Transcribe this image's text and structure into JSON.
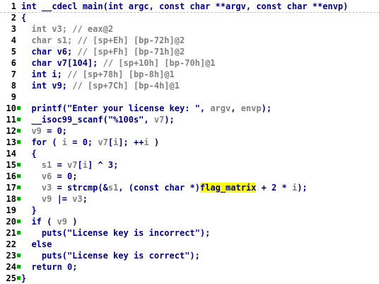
{
  "editor": {
    "colors": {
      "keyword": "#000080",
      "variable": "#000080",
      "comment": "#808080",
      "string": "#008000",
      "number": "#008000",
      "highlight": "#ffff00",
      "breakpoint_dot": "#00a000"
    },
    "lines": [
      {
        "num": "1",
        "dot": false,
        "tokens": [
          {
            "t": "int __cdecl main(int argc, const char **argv, const char **envp)",
            "c": "t-black"
          }
        ]
      },
      {
        "num": "2",
        "dot": false,
        "tokens": [
          {
            "t": "{",
            "c": "t-black"
          }
        ]
      },
      {
        "num": "3",
        "dot": false,
        "tokens": [
          {
            "t": "  int v3; ",
            "c": "t-dim"
          },
          {
            "t": "// eax@2",
            "c": "t-cmt"
          }
        ]
      },
      {
        "num": "4",
        "dot": false,
        "tokens": [
          {
            "t": "  char s1; ",
            "c": "t-dim"
          },
          {
            "t": "// [sp+Eh] [bp-72h]@2",
            "c": "t-cmt"
          }
        ]
      },
      {
        "num": "5",
        "dot": false,
        "tokens": [
          {
            "t": "  char v6; ",
            "c": "t-black"
          },
          {
            "t": "// [sp+Fh] [bp-71h]@2",
            "c": "t-cmt"
          }
        ]
      },
      {
        "num": "6",
        "dot": false,
        "tokens": [
          {
            "t": "  char v7[104]; ",
            "c": "t-black"
          },
          {
            "t": "// [sp+10h] [bp-70h]@1",
            "c": "t-cmt"
          }
        ]
      },
      {
        "num": "7",
        "dot": false,
        "tokens": [
          {
            "t": "  int i; ",
            "c": "t-black"
          },
          {
            "t": "// [sp+78h] [bp-8h]@1",
            "c": "t-cmt"
          }
        ]
      },
      {
        "num": "8",
        "dot": false,
        "tokens": [
          {
            "t": "  int v9; ",
            "c": "t-black"
          },
          {
            "t": "// [sp+7Ch] [bp-4h]@1",
            "c": "t-cmt"
          }
        ]
      },
      {
        "num": "9",
        "dot": false,
        "tokens": [
          {
            "t": "",
            "c": "t-black"
          }
        ]
      },
      {
        "num": "10",
        "dot": true,
        "tokens": [
          {
            "t": "  printf(",
            "c": "t-black"
          },
          {
            "t": "\"Enter your license key: \"",
            "c": "t-black"
          },
          {
            "t": ", ",
            "c": "t-black"
          },
          {
            "t": "argv",
            "c": "t-dim"
          },
          {
            "t": ", ",
            "c": "t-black"
          },
          {
            "t": "envp",
            "c": "t-dim"
          },
          {
            "t": ");",
            "c": "t-black"
          }
        ]
      },
      {
        "num": "11",
        "dot": true,
        "tokens": [
          {
            "t": "  __isoc99_scanf(",
            "c": "t-black"
          },
          {
            "t": "\"%100s\"",
            "c": "t-black"
          },
          {
            "t": ", ",
            "c": "t-black"
          },
          {
            "t": "v7",
            "c": "t-dim"
          },
          {
            "t": ");",
            "c": "t-black"
          }
        ]
      },
      {
        "num": "12",
        "dot": true,
        "tokens": [
          {
            "t": "  ",
            "c": "t-black"
          },
          {
            "t": "v9",
            "c": "t-dim"
          },
          {
            "t": " = 0;",
            "c": "t-black"
          }
        ]
      },
      {
        "num": "13",
        "dot": true,
        "tokens": [
          {
            "t": "  for ( ",
            "c": "t-black"
          },
          {
            "t": "i",
            "c": "t-dim"
          },
          {
            "t": " = 0; ",
            "c": "t-black"
          },
          {
            "t": "v7",
            "c": "t-dim"
          },
          {
            "t": "[",
            "c": "t-black"
          },
          {
            "t": "i",
            "c": "t-dim"
          },
          {
            "t": "]; ++",
            "c": "t-black"
          },
          {
            "t": "i",
            "c": "t-dim"
          },
          {
            "t": " )",
            "c": "t-black"
          }
        ]
      },
      {
        "num": "14",
        "dot": false,
        "tokens": [
          {
            "t": "  {",
            "c": "t-black"
          }
        ]
      },
      {
        "num": "15",
        "dot": true,
        "tokens": [
          {
            "t": "    ",
            "c": "t-black"
          },
          {
            "t": "s1",
            "c": "t-dim"
          },
          {
            "t": " = ",
            "c": "t-black"
          },
          {
            "t": "v7",
            "c": "t-dim"
          },
          {
            "t": "[",
            "c": "t-black"
          },
          {
            "t": "i",
            "c": "t-dim"
          },
          {
            "t": "] ^ 3;",
            "c": "t-black"
          }
        ]
      },
      {
        "num": "16",
        "dot": true,
        "tokens": [
          {
            "t": "    ",
            "c": "t-black"
          },
          {
            "t": "v6",
            "c": "t-dim"
          },
          {
            "t": " = 0;",
            "c": "t-black"
          }
        ]
      },
      {
        "num": "17",
        "dot": true,
        "tokens": [
          {
            "t": "    ",
            "c": "t-black"
          },
          {
            "t": "v3",
            "c": "t-dim"
          },
          {
            "t": " = strcmp(&",
            "c": "t-black"
          },
          {
            "t": "s1",
            "c": "t-dim"
          },
          {
            "t": ", (const char *)",
            "c": "t-black"
          },
          {
            "t": "flag_matrix",
            "c": "hl"
          },
          {
            "t": " + 2 * ",
            "c": "t-black"
          },
          {
            "t": "i",
            "c": "t-dim"
          },
          {
            "t": ");",
            "c": "t-black"
          }
        ]
      },
      {
        "num": "18",
        "dot": true,
        "tokens": [
          {
            "t": "    ",
            "c": "t-black"
          },
          {
            "t": "v9",
            "c": "t-dim"
          },
          {
            "t": " |= ",
            "c": "t-black"
          },
          {
            "t": "v3",
            "c": "t-dim"
          },
          {
            "t": ";",
            "c": "t-black"
          }
        ]
      },
      {
        "num": "19",
        "dot": false,
        "tokens": [
          {
            "t": "  }",
            "c": "t-black"
          }
        ]
      },
      {
        "num": "20",
        "dot": true,
        "tokens": [
          {
            "t": "  if ( ",
            "c": "t-black"
          },
          {
            "t": "v9",
            "c": "t-dim"
          },
          {
            "t": " )",
            "c": "t-black"
          }
        ]
      },
      {
        "num": "21",
        "dot": true,
        "tokens": [
          {
            "t": "    puts(",
            "c": "t-black"
          },
          {
            "t": "\"License key is incorrect\"",
            "c": "t-black"
          },
          {
            "t": ");",
            "c": "t-black"
          }
        ]
      },
      {
        "num": "22",
        "dot": false,
        "tokens": [
          {
            "t": "  else",
            "c": "t-black"
          }
        ]
      },
      {
        "num": "23",
        "dot": true,
        "tokens": [
          {
            "t": "    puts(",
            "c": "t-black"
          },
          {
            "t": "\"License key is correct\"",
            "c": "t-black"
          },
          {
            "t": ");",
            "c": "t-black"
          }
        ]
      },
      {
        "num": "24",
        "dot": true,
        "tokens": [
          {
            "t": "  return 0;",
            "c": "t-black"
          }
        ]
      },
      {
        "num": "25",
        "dot": true,
        "tokens": [
          {
            "t": "}",
            "c": "t-black"
          }
        ]
      }
    ]
  }
}
